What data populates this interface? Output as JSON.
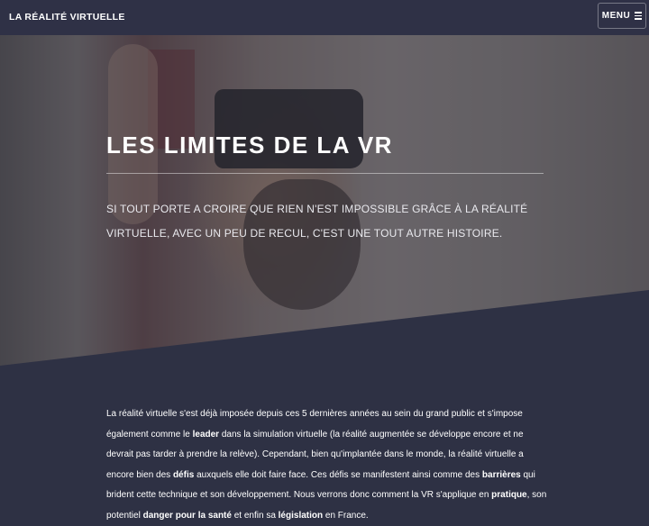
{
  "header": {
    "brand": "LA RÉALITÉ VIRTUELLE",
    "menu_label": "MENU"
  },
  "hero": {
    "title": "LES LIMITES DE LA VR",
    "subtitle": "SI TOUT PORTE A CROIRE QUE RIEN N'EST IMPOSSIBLE GRÂCE À LA RÉALITÉ VIRTUELLE, AVEC UN PEU DE RECUL, C'EST UNE TOUT AUTRE HISTOIRE."
  },
  "intro": {
    "t1": "La réalité virtuelle s'est déjà imposée depuis ces 5 dernières années au sein du grand public et s'impose également comme le ",
    "b1": "leader",
    "t2": " dans la simulation virtuelle (la réalité augmentée se développe encore et ne devrait pas tarder à prendre la relève). Cependant, bien qu'implantée dans le monde, la réalité virtuelle a encore bien des ",
    "b2": "défis",
    "t3": " auxquels elle doit faire face. Ces défis se manifestent ainsi comme des ",
    "b3": "barrières",
    "t4": " qui brident cette technique et son développement. Nous verrons donc comment la VR s'applique en ",
    "b4": "pratique",
    "t5": ", son potentiel ",
    "b5": "danger pour la santé",
    "t6": " et enfin sa ",
    "b6": "législation",
    "t7": " en France."
  },
  "colors": {
    "background": "#2e3144",
    "header": "#2f3146"
  },
  "icons": {
    "menu": "hamburger-icon"
  }
}
